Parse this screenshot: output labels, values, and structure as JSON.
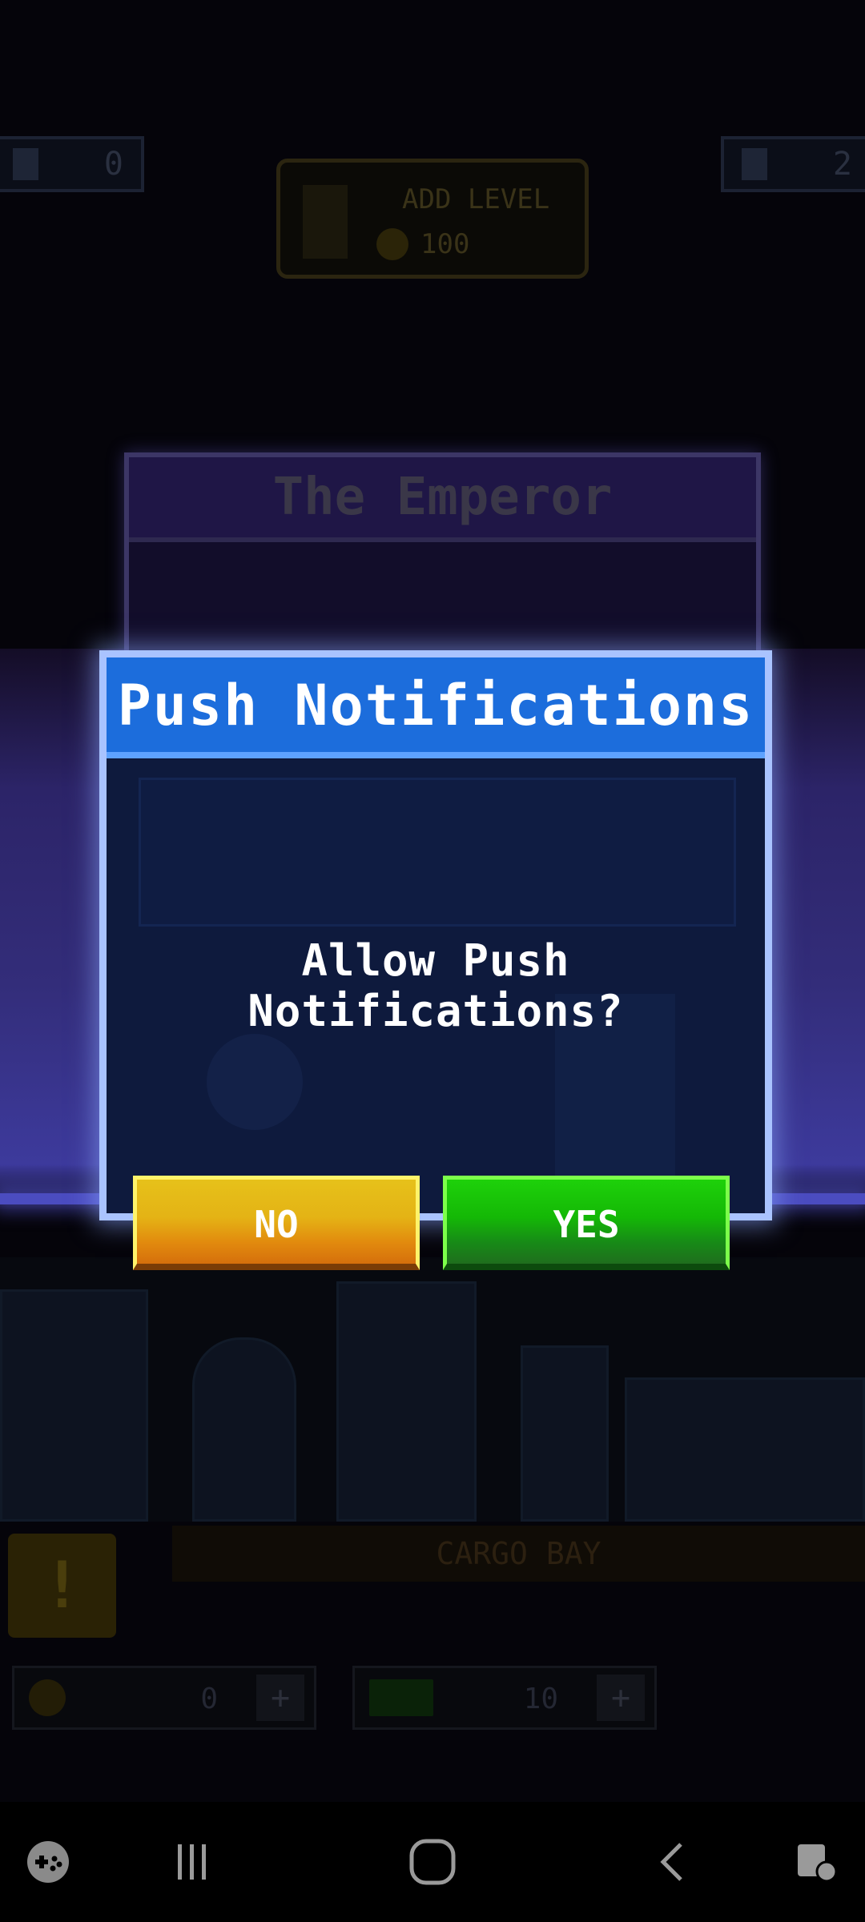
{
  "hud": {
    "residents_count": "0",
    "floors_count": "2"
  },
  "add_level": {
    "title": "ADD LEVEL",
    "cost": "100"
  },
  "background_floor": {
    "name": "The Emperor"
  },
  "room": {
    "label": "CARGO BAY",
    "alert_symbol": "!"
  },
  "resources": {
    "coins": "0",
    "cash": "10",
    "plus_symbol": "+"
  },
  "dialog": {
    "title": "Push Notifications",
    "message": "Allow Push Notifications?",
    "no_label": "NO",
    "yes_label": "YES"
  },
  "colors": {
    "title_bar": "#1c6ddc",
    "dialog_border": "#a9c3ff",
    "no_button": "#e4b315",
    "yes_button": "#14b806"
  },
  "nav_bar": {
    "icons": [
      "game-launcher-icon",
      "recents-icon",
      "home-icon",
      "back-icon",
      "assistant-icon"
    ]
  }
}
